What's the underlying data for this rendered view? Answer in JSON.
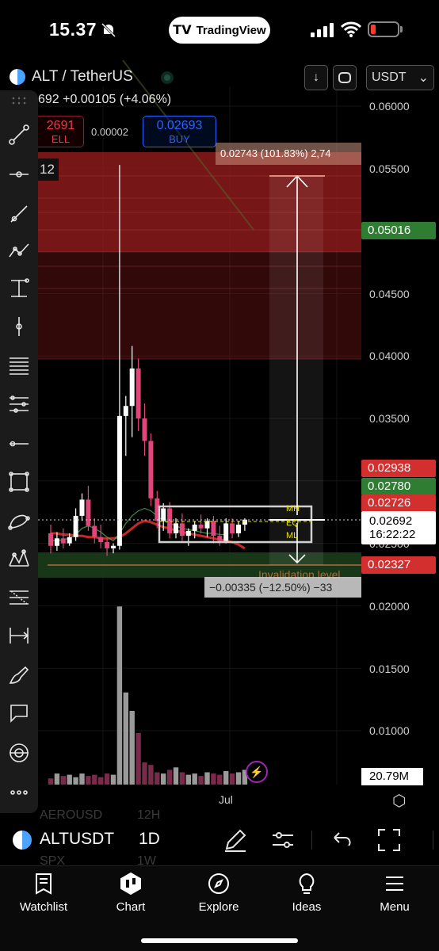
{
  "status_bar": {
    "time": "15.37",
    "app_pill": "TradingView",
    "battery_color": "#ff3b30"
  },
  "header": {
    "symbol": "ALT / TetherUS",
    "price_line": "692 +0.00105 (+4.06%)",
    "currency": "USDT",
    "currency_chevron": "⌄"
  },
  "trade": {
    "sell_price": "2691",
    "sell_label": "ELL",
    "spread": "0.00002",
    "buy_price": "0.02693",
    "buy_label": "BUY"
  },
  "chart": {
    "interval_partial": "12",
    "target_label": "0.02743 (101.83%) 2,74",
    "stop_label": "−0.00335 (−12.50%) −33",
    "invalidation_label": "Invalidation level",
    "range_labels": [
      "MH",
      "EQ",
      "ML"
    ],
    "time_label": "Jul",
    "colors": {
      "up": "#ffffff",
      "down": "#e0457b",
      "profit_zone": "#8b1a1a",
      "stop_zone": "#1b3d1b",
      "ma_red": "#c62828",
      "ma_green": "#4caf50"
    }
  },
  "price_axis": {
    "labels": [
      "0.06000",
      "0.05500",
      "0.04500",
      "0.04000",
      "0.03500",
      "0.02500",
      "0.02000",
      "0.01500",
      "0.01000"
    ],
    "badges": [
      {
        "value": "0.05016",
        "color": "#2e7d32"
      },
      {
        "value": "0.02938",
        "color": "#d32f2f"
      },
      {
        "value": "0.02780",
        "color": "#2e7d32"
      },
      {
        "value": "0.02726",
        "color": "#d32f2f"
      },
      {
        "value": "0.02327",
        "color": "#d32f2f"
      }
    ],
    "current_price": "0.02692",
    "countdown": "16:22:22",
    "volume": "20.79M"
  },
  "chart_data": {
    "type": "candlestick",
    "x_axis_label": "Jul",
    "ylim": [
      0.005,
      0.0625
    ],
    "candles": [
      {
        "o": 0.0258,
        "h": 0.0265,
        "l": 0.0242,
        "c": 0.0248
      },
      {
        "o": 0.0248,
        "h": 0.0259,
        "l": 0.0244,
        "c": 0.0254
      },
      {
        "o": 0.0254,
        "h": 0.0262,
        "l": 0.0246,
        "c": 0.025
      },
      {
        "o": 0.025,
        "h": 0.0258,
        "l": 0.0248,
        "c": 0.0255
      },
      {
        "o": 0.0255,
        "h": 0.0278,
        "l": 0.0252,
        "c": 0.0272
      },
      {
        "o": 0.0272,
        "h": 0.029,
        "l": 0.0268,
        "c": 0.0285
      },
      {
        "o": 0.0285,
        "h": 0.0296,
        "l": 0.026,
        "c": 0.0264
      },
      {
        "o": 0.0264,
        "h": 0.027,
        "l": 0.025,
        "c": 0.0255
      },
      {
        "o": 0.0255,
        "h": 0.0265,
        "l": 0.0246,
        "c": 0.0251
      },
      {
        "o": 0.0251,
        "h": 0.0254,
        "l": 0.024,
        "c": 0.0246
      },
      {
        "o": 0.0246,
        "h": 0.025,
        "l": 0.0242,
        "c": 0.0248
      },
      {
        "o": 0.0248,
        "h": 0.0553,
        "l": 0.0245,
        "c": 0.0352
      },
      {
        "o": 0.0352,
        "h": 0.0368,
        "l": 0.032,
        "c": 0.036
      },
      {
        "o": 0.036,
        "h": 0.0408,
        "l": 0.0335,
        "c": 0.039
      },
      {
        "o": 0.039,
        "h": 0.0398,
        "l": 0.034,
        "c": 0.035
      },
      {
        "o": 0.035,
        "h": 0.0362,
        "l": 0.032,
        "c": 0.0332
      },
      {
        "o": 0.0332,
        "h": 0.0338,
        "l": 0.028,
        "c": 0.0286
      },
      {
        "o": 0.0286,
        "h": 0.0292,
        "l": 0.0262,
        "c": 0.0268
      },
      {
        "o": 0.0268,
        "h": 0.0282,
        "l": 0.026,
        "c": 0.0278
      },
      {
        "o": 0.0278,
        "h": 0.0283,
        "l": 0.0254,
        "c": 0.0258
      },
      {
        "o": 0.0258,
        "h": 0.027,
        "l": 0.0254,
        "c": 0.0266
      },
      {
        "o": 0.0266,
        "h": 0.0274,
        "l": 0.0252,
        "c": 0.0256
      },
      {
        "o": 0.0256,
        "h": 0.0262,
        "l": 0.0248,
        "c": 0.026
      },
      {
        "o": 0.026,
        "h": 0.0268,
        "l": 0.0254,
        "c": 0.0265
      },
      {
        "o": 0.0265,
        "h": 0.0273,
        "l": 0.0258,
        "c": 0.0262
      },
      {
        "o": 0.0262,
        "h": 0.027,
        "l": 0.0255,
        "c": 0.0268
      },
      {
        "o": 0.0268,
        "h": 0.0272,
        "l": 0.025,
        "c": 0.0256
      },
      {
        "o": 0.0256,
        "h": 0.0264,
        "l": 0.0248,
        "c": 0.0252
      },
      {
        "o": 0.0252,
        "h": 0.027,
        "l": 0.025,
        "c": 0.0266
      },
      {
        "o": 0.0266,
        "h": 0.027,
        "l": 0.0254,
        "c": 0.0258
      },
      {
        "o": 0.0258,
        "h": 0.0268,
        "l": 0.0255,
        "c": 0.0265
      },
      {
        "o": 0.0265,
        "h": 0.027,
        "l": 0.026,
        "c": 0.0269
      }
    ],
    "volume": [
      5,
      9,
      7,
      8,
      6,
      9,
      7,
      8,
      6,
      9,
      8,
      145,
      75,
      60,
      42,
      18,
      16,
      10,
      9,
      12,
      14,
      10,
      8,
      9,
      7,
      10,
      9,
      8,
      11,
      9,
      10,
      12
    ],
    "ma_red": [
      0.0258,
      0.0258,
      0.0257,
      0.0257,
      0.0256,
      0.0256,
      0.0255,
      0.0255,
      0.0254,
      0.0254,
      0.0254,
      0.0255,
      0.0258,
      0.0262,
      0.0266,
      0.0268,
      0.0267,
      0.0265,
      0.0263,
      0.0262,
      0.026,
      0.0259,
      0.0258,
      0.0257,
      0.0256,
      0.0255,
      0.0254,
      0.0253,
      0.0252,
      0.0251,
      0.0249,
      0.0246
    ],
    "ma_green": [
      0.0252,
      0.0252,
      0.0253,
      0.0254,
      0.0257,
      0.0262,
      0.0264,
      0.0262,
      0.0259,
      0.0255,
      0.0252,
      0.0258,
      0.0266,
      0.0272,
      0.0276,
      0.0278,
      0.0276,
      0.0272,
      0.0268,
      0.0266,
      0.0264,
      0.0262,
      0.0261,
      0.026,
      0.0259,
      0.0258,
      0.0258,
      0.0257,
      0.0257
    ]
  },
  "toolbar_icons": [
    "drag-handle-icon",
    "cursor-icon",
    "trend-line-icon",
    "horizontal-ray-icon",
    "ray-icon",
    "pitchfork-icon",
    "vertical-line-icon",
    "vertical-ray-icon",
    "fib-icon",
    "parallel-channel-icon",
    "horizontal-line-icon",
    "rectangle-icon",
    "curve-icon",
    "pattern-icon",
    "gann-icon",
    "measure-icon",
    "brush-icon",
    "callout-icon",
    "eye-icon",
    "more-icon"
  ],
  "ghost_list": {
    "row1_sym": "AEROUSD",
    "row1_int": "12H",
    "row2_sym": "SPX",
    "row2_int": "1W"
  },
  "symbol_bar": {
    "symbol": "ALTUSDT",
    "interval": "1D"
  },
  "tabs": [
    {
      "label": "Watchlist",
      "icon": "watchlist-icon"
    },
    {
      "label": "Chart",
      "icon": "chart-icon"
    },
    {
      "label": "Explore",
      "icon": "compass-icon"
    },
    {
      "label": "Ideas",
      "icon": "lightbulb-icon"
    },
    {
      "label": "Menu",
      "icon": "menu-icon"
    }
  ]
}
